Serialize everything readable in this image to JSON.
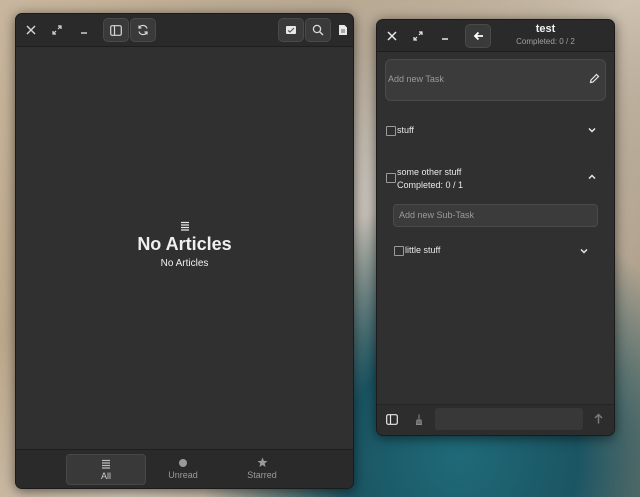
{
  "reader": {
    "empty_icon": "list-icon",
    "empty_title": "No Articles",
    "empty_subtitle": "No Articles",
    "tabs": [
      {
        "label": "All",
        "icon": "list-icon",
        "active": true
      },
      {
        "label": "Unread",
        "icon": "dot-icon",
        "active": false
      },
      {
        "label": "Starred",
        "icon": "star-icon",
        "active": false
      }
    ]
  },
  "todo": {
    "title": "test",
    "subtitle": "Completed: 0 / 2",
    "new_task_placeholder": "Add new Task",
    "tasks": [
      {
        "label": "stuff",
        "completed_text": "",
        "expanded": false
      },
      {
        "label": "some other stuff",
        "completed_text": "Completed: 0 / 1",
        "expanded": true,
        "sub_placeholder": "Add new Sub-Task",
        "subtasks": [
          {
            "label": "little stuff",
            "expanded": false
          }
        ]
      }
    ]
  },
  "colors": {
    "window_bg": "#303030",
    "titlebar_bg": "#2a2a2a",
    "text": "#e8e8e8",
    "muted": "#9a9a9a"
  }
}
